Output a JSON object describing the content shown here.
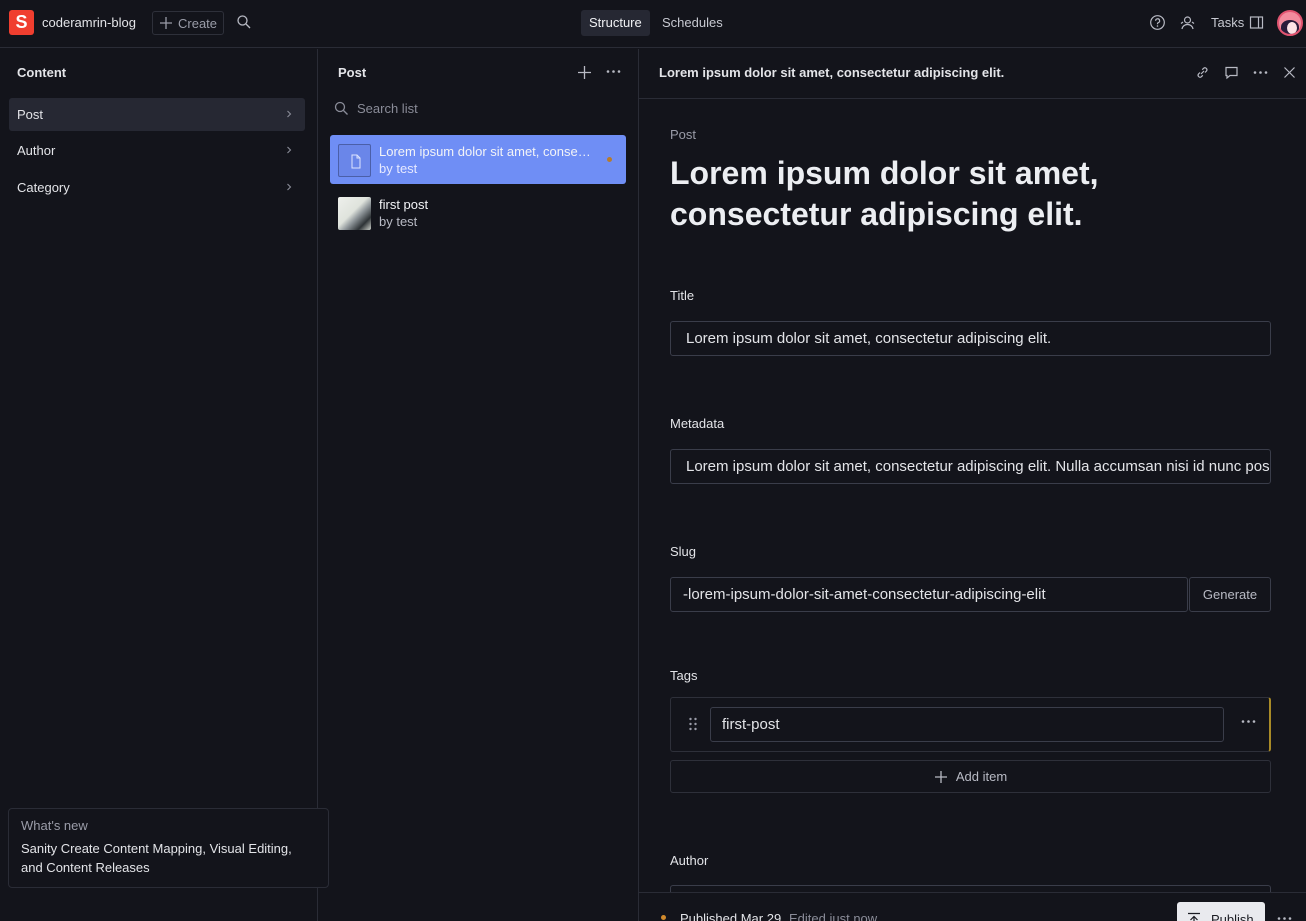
{
  "topbar": {
    "logo_letter": "S",
    "project_name": "coderamrin-blog",
    "create_label": "Create",
    "tabs": [
      {
        "label": "Structure",
        "active": true
      },
      {
        "label": "Schedules",
        "active": false
      }
    ],
    "tasks_label": "Tasks"
  },
  "content_pane": {
    "title": "Content",
    "items": [
      {
        "label": "Post",
        "active": true
      },
      {
        "label": "Author",
        "active": false
      },
      {
        "label": "Category",
        "active": false
      }
    ]
  },
  "whats_new": {
    "label": "What's new",
    "text": "Sanity Create Content Mapping, Visual Editing, and Content Releases"
  },
  "post_pane": {
    "title": "Post",
    "search_placeholder": "Search list",
    "documents": [
      {
        "title": "Lorem ipsum dolor sit amet, consectetur adipiscing elit.",
        "subtitle": "by test",
        "active": true,
        "status": "edited"
      },
      {
        "title": "first post",
        "subtitle": "by test",
        "active": false
      }
    ]
  },
  "editor": {
    "header_title": "Lorem ipsum dolor sit amet, consectetur adipiscing elit.",
    "doc_type": "Post",
    "heading": "Lorem ipsum dolor sit amet, consectetur adipiscing elit.",
    "fields": {
      "title_label": "Title",
      "title_value": "Lorem ipsum dolor sit amet, consectetur adipiscing elit.",
      "metadata_label": "Metadata",
      "metadata_value": "Lorem ipsum dolor sit amet, consectetur adipiscing elit. Nulla accumsan nisi id nunc posuere",
      "slug_label": "Slug",
      "slug_value": "-lorem-ipsum-dolor-sit-amet-consectetur-adipiscing-elit",
      "generate_label": "Generate",
      "tags_label": "Tags",
      "tags": [
        "first-post"
      ],
      "add_item_label": "Add item",
      "author_label": "Author"
    },
    "footer": {
      "published_label": "Published Mar 29",
      "edited_label": "Edited just now",
      "publish_button": "Publish"
    }
  },
  "colors": {
    "brand": "#f03e2f",
    "selected_doc": "#6f8ef5",
    "background": "#13141b",
    "publish_button": "#e9eaee"
  }
}
